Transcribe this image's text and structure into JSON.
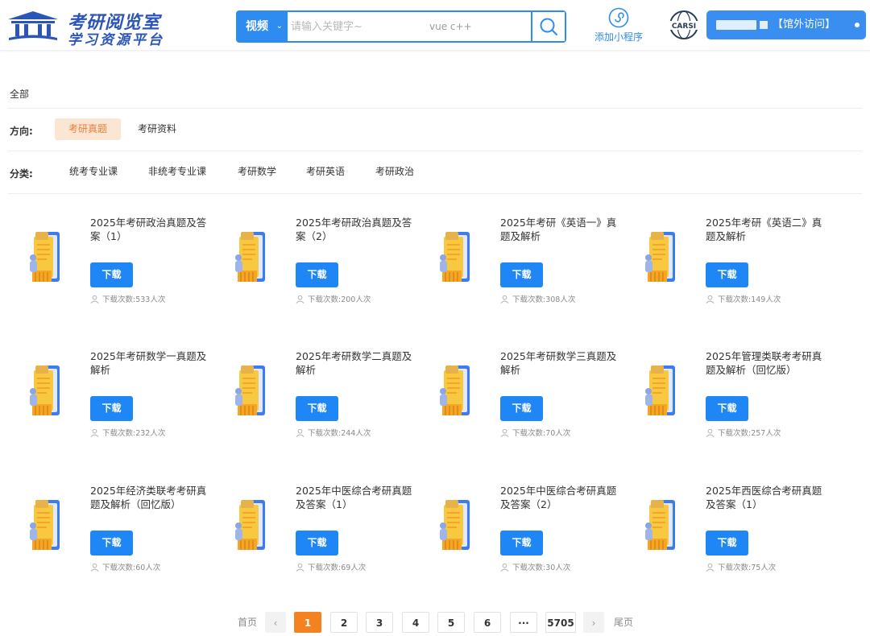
{
  "header": {
    "logo_line1": "考研阅览室",
    "logo_line2": "学习资源平台",
    "search_category": "视频",
    "search_placeholder": "请输入关键字~",
    "search_hint": "vue c++",
    "mini_program_label": "添加小程序",
    "carsi_text": "CARSI",
    "visit_label": "【馆外访问】"
  },
  "filters": {
    "all_label": "全部",
    "direction_label": "方向:",
    "direction_options": [
      "考研真题",
      "考研资料"
    ],
    "direction_active": "考研真题",
    "category_label": "分类:",
    "category_options": [
      "统考专业课",
      "非统考专业课",
      "考研数学",
      "考研英语",
      "考研政治"
    ]
  },
  "download_label": "下载",
  "count_prefix": "下载次数:",
  "items": [
    {
      "title": "2025年考研政治真题及答案（1）",
      "count": "533人次"
    },
    {
      "title": "2025年考研政治真题及答案（2）",
      "count": "200人次"
    },
    {
      "title": "2025年考研《英语一》真题及解析",
      "count": "308人次"
    },
    {
      "title": "2025年考研《英语二》真题及解析",
      "count": "149人次"
    },
    {
      "title": "2025年考研数学一真题及解析",
      "count": "232人次"
    },
    {
      "title": "2025年考研数学二真题及解析",
      "count": "244人次"
    },
    {
      "title": "2025年考研数学三真题及解析",
      "count": "70人次"
    },
    {
      "title": "2025年管理类联考考研真题及解析（回忆版）",
      "count": "257人次"
    },
    {
      "title": "2025年经济类联考考研真题及解析（回忆版）",
      "count": "60人次"
    },
    {
      "title": "2025年中医综合考研真题及答案（1）",
      "count": "69人次"
    },
    {
      "title": "2025年中医综合考研真题及答案（2）",
      "count": "30人次"
    },
    {
      "title": "2025年西医综合考研真题及答案（1）",
      "count": "75人次"
    }
  ],
  "pagination": {
    "first_label": "首页",
    "prev_icon": "chevron-left-icon",
    "pages": [
      "1",
      "2",
      "3",
      "4",
      "5",
      "6"
    ],
    "current": "1",
    "ellipsis": "···",
    "last_page": "5705",
    "next_icon": "chevron-right-icon",
    "last_label": "尾页"
  },
  "colors": {
    "primary_blue": "#1f86f5",
    "accent_orange": "#f58220",
    "active_tag_bg": "#fbe5d3",
    "active_tag_text": "#e9803a"
  }
}
